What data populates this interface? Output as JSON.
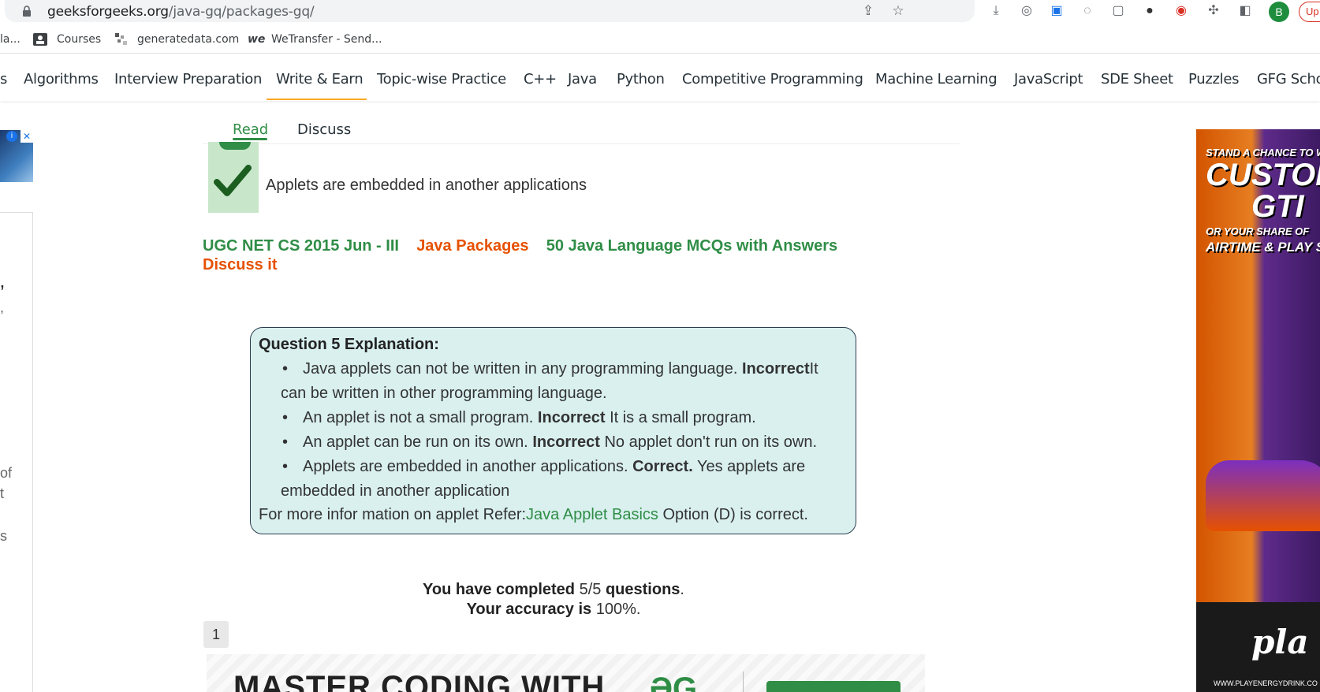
{
  "browser": {
    "url_host": "geeksforgeeks.org",
    "url_path": "/java-gq/packages-gq/",
    "profile_initial": "B",
    "update_label": "Up"
  },
  "bookmarks": [
    {
      "label": "la..."
    },
    {
      "label": "Courses"
    },
    {
      "label": "generatedata.com"
    },
    {
      "label": "WeTransfer - Send..."
    }
  ],
  "nav": {
    "items": [
      "s",
      "Algorithms",
      "Interview Preparation",
      "Write & Earn",
      "Topic-wise Practice",
      "C++",
      "Java",
      "Python",
      "Competitive Programming",
      "Machine Learning",
      "JavaScript",
      "SDE Sheet",
      "Puzzles",
      "GFG Scho"
    ]
  },
  "tabs": {
    "read": "Read",
    "discuss": "Discuss"
  },
  "left_fragments": [
    "’",
    ",",
    "of",
    "t",
    "s"
  ],
  "option": {
    "text": "Applets are embedded in another applications"
  },
  "tags": {
    "t1": "UGC NET CS 2015 Jun - III",
    "t2": "Java Packages",
    "t3": "50 Java Language MCQs with Answers",
    "discuss": "Discuss it"
  },
  "explanation": {
    "title": "Question 5 Explanation:",
    "items": [
      {
        "pre": "Java applets can not be written in any programming language. ",
        "bold": "Incorrect",
        "post": "It",
        "cont": "can be written in other programming language."
      },
      {
        "pre": "An applet is not a small program. ",
        "bold": "Incorrect",
        "post": " It is a small program.",
        "cont": ""
      },
      {
        "pre": "An applet can be run on its own. ",
        "bold": "Incorrect",
        "post": " No applet don't run on its own.",
        "cont": ""
      },
      {
        "pre": "Applets are embedded in another applications. ",
        "bold": "Correct.",
        "post": " Yes applets are",
        "cont": "embedded in another application"
      }
    ],
    "footer_pre": "For more infor mation on applet Refer:",
    "footer_link": "Java Applet Basics",
    "footer_post": " Option (D) is correct."
  },
  "result": {
    "l1_a": "You have completed",
    "l1_b": " 5/5 ",
    "l1_c": "questions",
    "l1_d": ".",
    "l2_a": "Your accuracy is",
    "l2_b": " 100%."
  },
  "pagination": {
    "page": "1"
  },
  "banner": {
    "text": "MASTER CODING WITH"
  },
  "right_ad": {
    "line1": "STAND A CHANCE TO WIN",
    "line2": "CUSTOM",
    "line3": "GTI",
    "line4": "OR YOUR SHARE OF",
    "line5": "AIRTIME & PLAY ST",
    "brand": "pla",
    "url": "WWW.PLAYENERGYDRINK.CO"
  }
}
